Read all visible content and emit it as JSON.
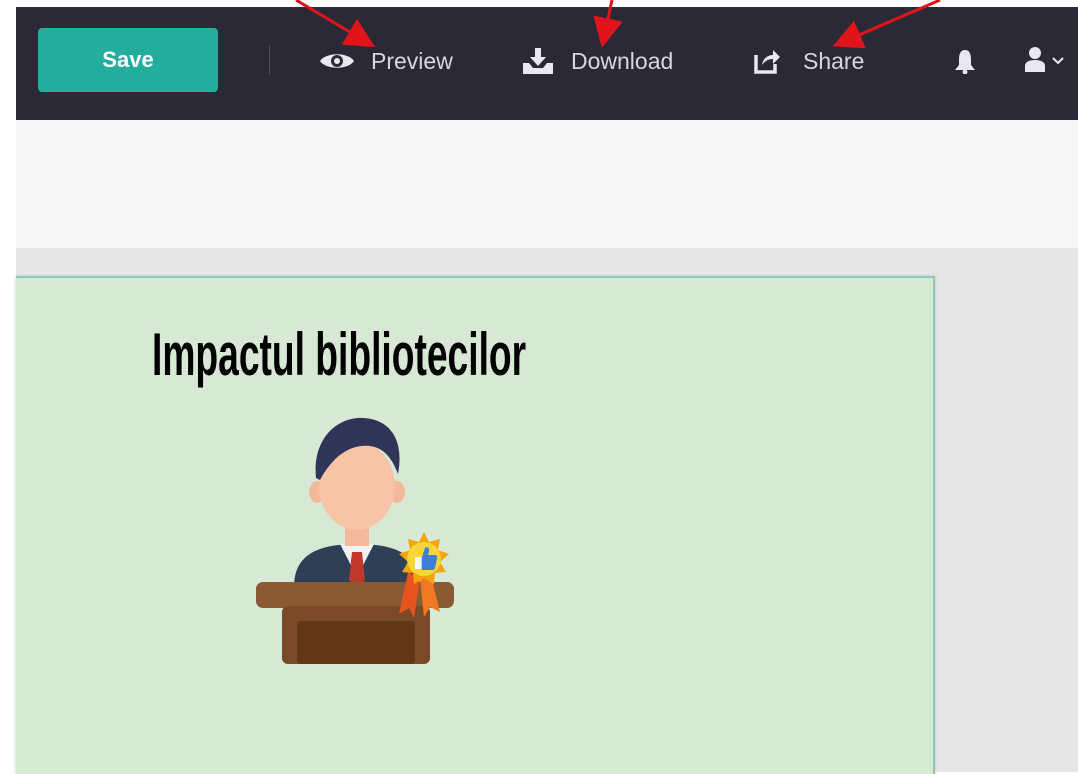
{
  "toolbar": {
    "save_label": "Save",
    "preview_label": "Preview",
    "download_label": "Download",
    "share_label": "Share",
    "icons": [
      "eye-icon",
      "download-icon",
      "share-icon",
      "bell-icon",
      "user-icon",
      "chevron-down-icon"
    ]
  },
  "slide": {
    "title": "Impactul bibliotecilor",
    "illustration": "speaker-at-podium-with-award-badge"
  },
  "colors": {
    "topbar_bg": "#2b2936",
    "save_button": "#22ad9c",
    "slide_bg": "#d7e9d4",
    "annotation_arrow": "#e0141b"
  },
  "annotations": [
    "arrow-to-preview",
    "arrow-to-download",
    "arrow-to-share"
  ]
}
